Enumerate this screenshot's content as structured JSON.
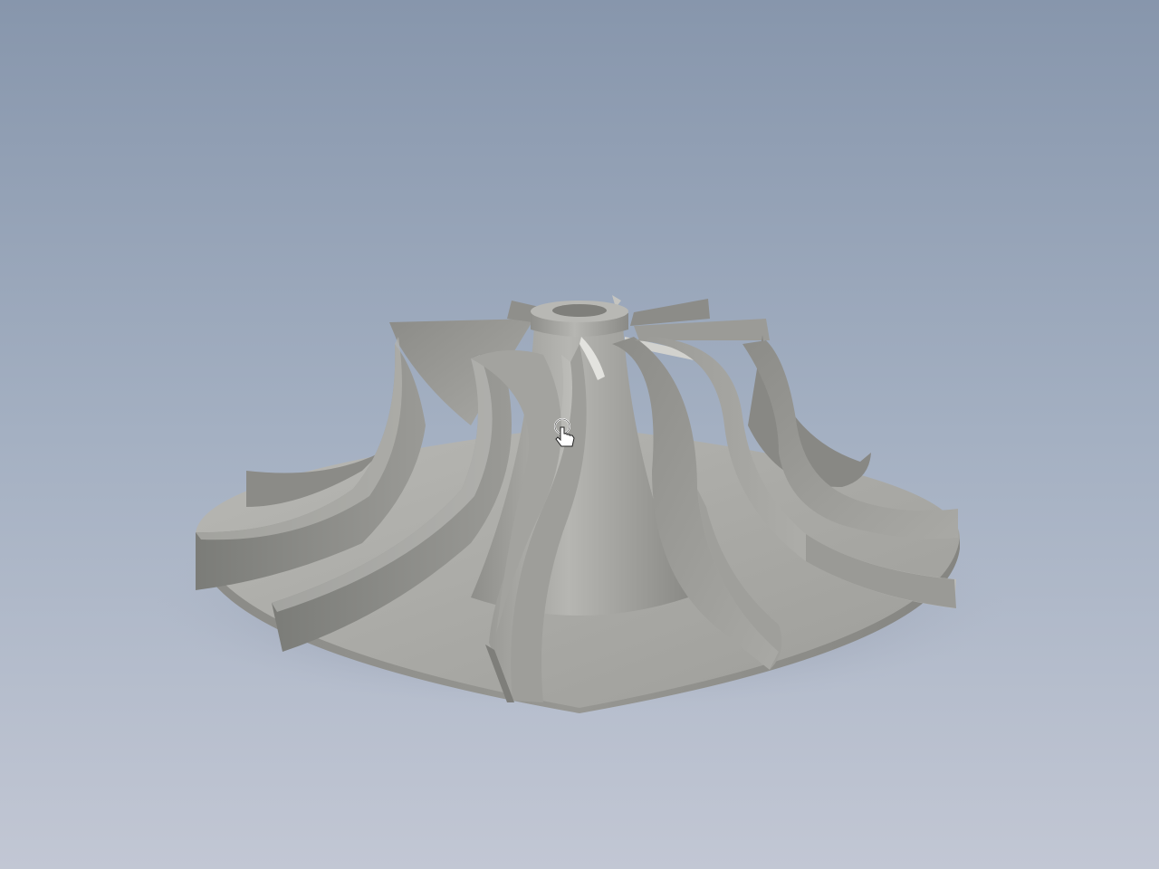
{
  "viewport": {
    "background_top": "#8796ac",
    "background_bottom": "#c2c7d4"
  },
  "model": {
    "part": "impeller",
    "material_color": "#a8a8a4",
    "shadow_color": "#6e6f6b",
    "highlight_color": "#c9c9c5",
    "blade_count": 12
  },
  "cursor": {
    "icon": "hand-pointer-icon"
  }
}
